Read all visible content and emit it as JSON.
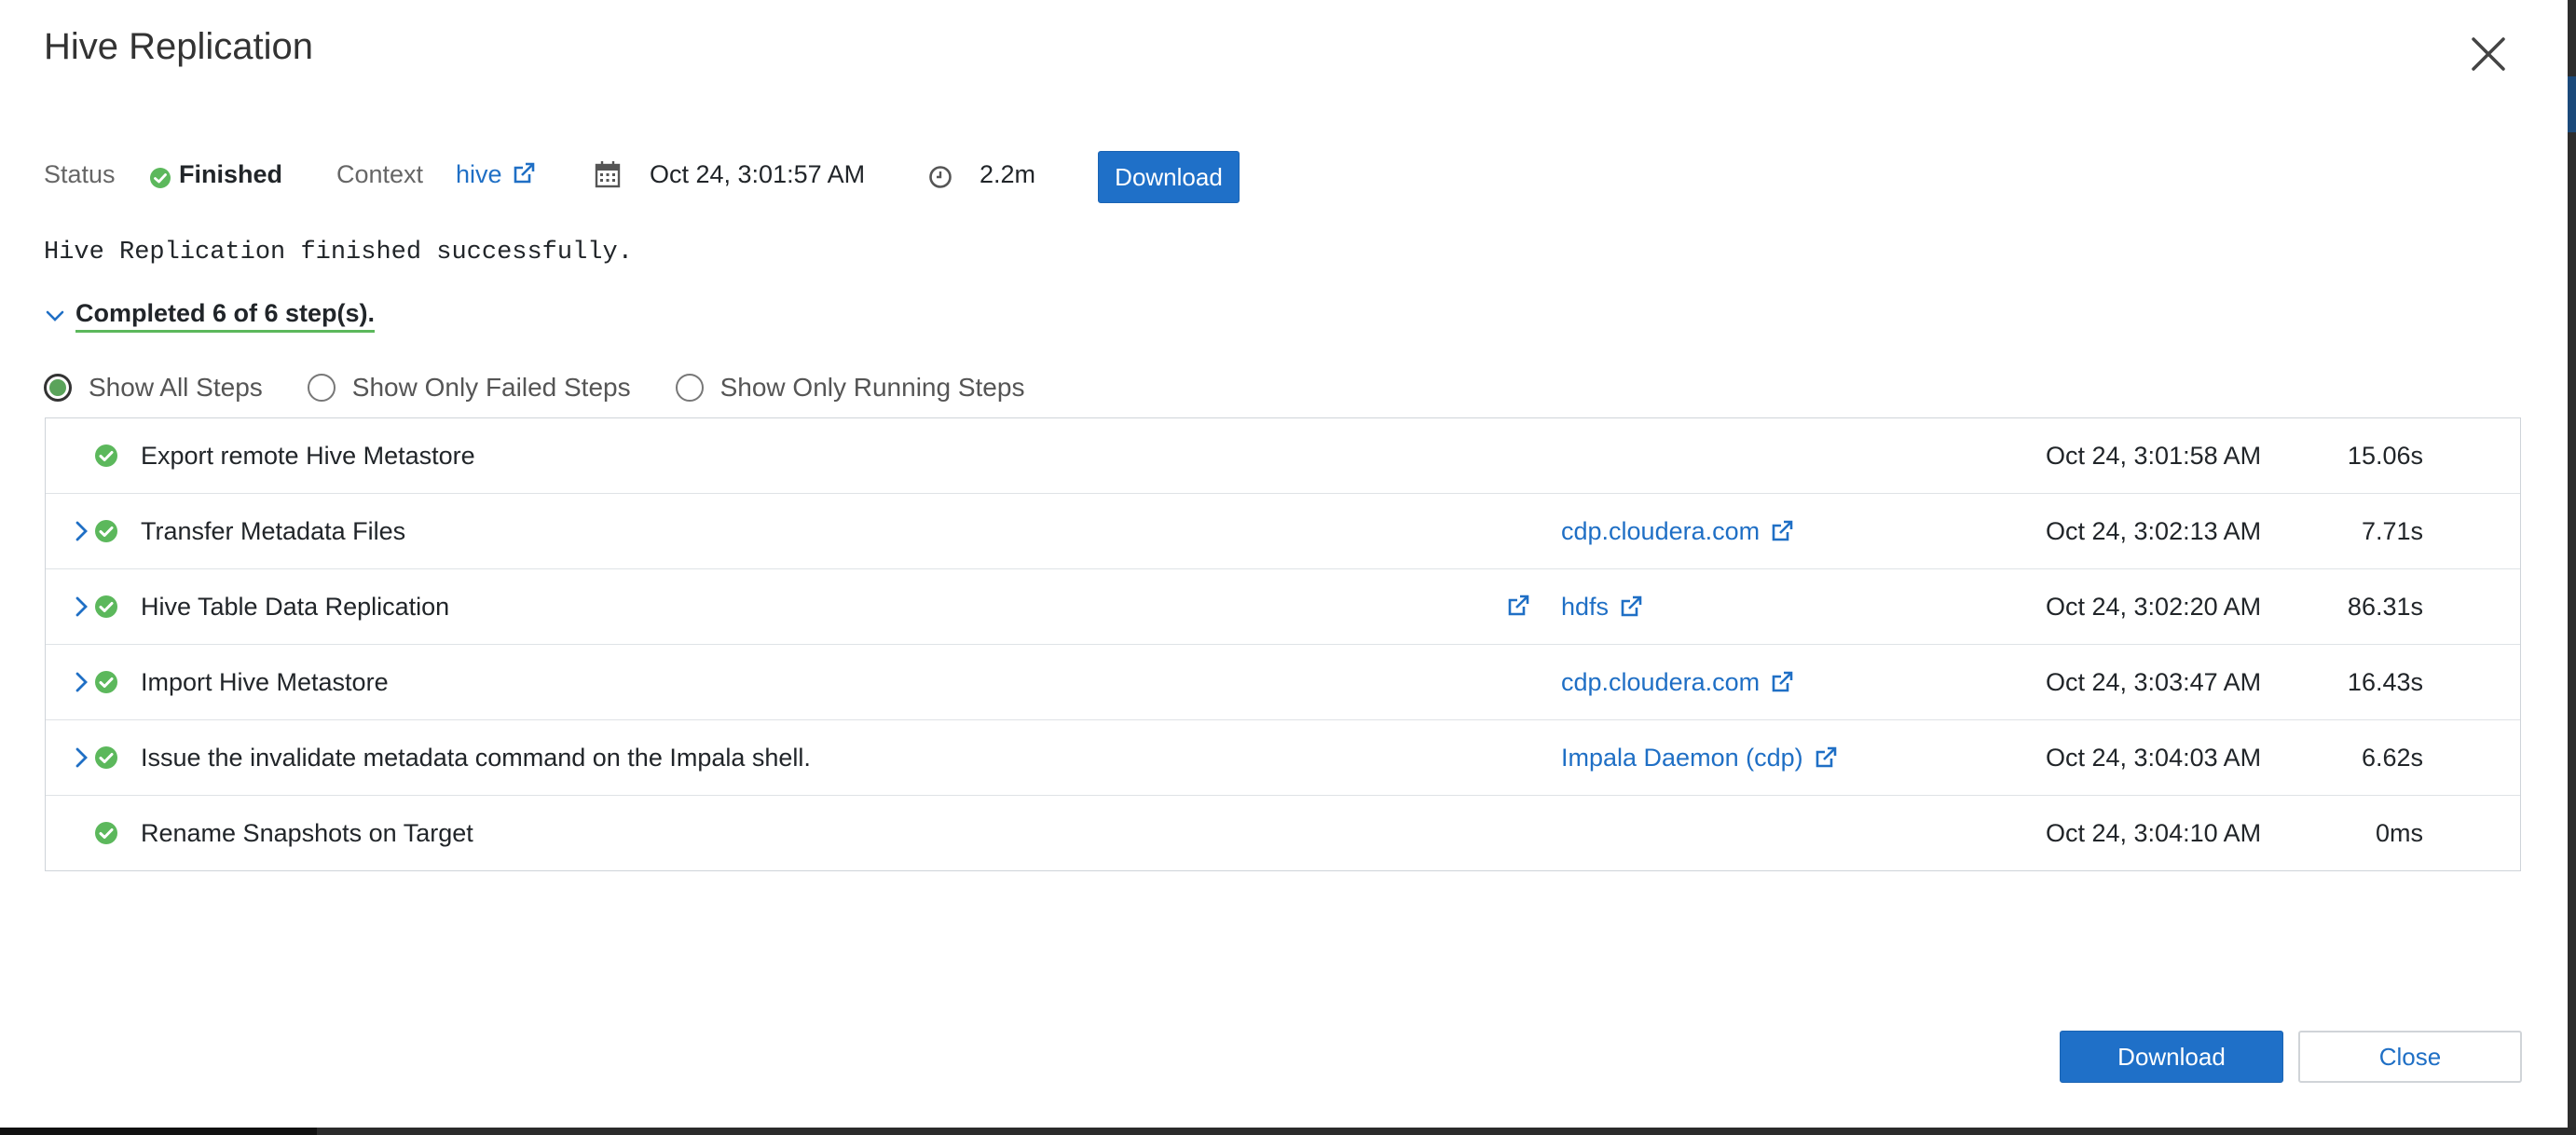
{
  "dialog": {
    "title": "Hive Replication",
    "close_icon": "close-icon"
  },
  "meta": {
    "status_label": "Status",
    "status_value": "Finished",
    "context_label": "Context",
    "context_value": "hive",
    "start_time": "Oct 24, 3:01:57 AM",
    "duration": "2.2m",
    "download_label": "Download"
  },
  "message": "Hive Replication finished successfully.",
  "summary": "Completed 6 of 6 step(s).",
  "filters": {
    "all": "Show All Steps",
    "failed": "Show Only Failed Steps",
    "running": "Show Only Running Steps",
    "selected": "all"
  },
  "steps": [
    {
      "name": "Export remote Hive Metastore",
      "context": "",
      "time": "Oct 24, 3:01:58 AM",
      "duration": "15.06s",
      "expandable": false
    },
    {
      "name": "Transfer Metadata Files",
      "context": "cdp.cloudera.com",
      "time": "Oct 24, 3:02:13 AM",
      "duration": "7.71s",
      "expandable": true
    },
    {
      "name": "Hive Table Data Replication",
      "context": "hdfs",
      "time": "Oct 24, 3:02:20 AM",
      "duration": "86.31s",
      "expandable": true
    },
    {
      "name": "Import Hive Metastore",
      "context": "cdp.cloudera.com",
      "time": "Oct 24, 3:03:47 AM",
      "duration": "16.43s",
      "expandable": true
    },
    {
      "name": "Issue the invalidate metadata command on the Impala shell.",
      "context": "Impala Daemon (cdp)",
      "time": "Oct 24, 3:04:03 AM",
      "duration": "6.62s",
      "expandable": true
    },
    {
      "name": "Rename Snapshots on Target",
      "context": "",
      "time": "Oct 24, 3:04:10 AM",
      "duration": "0ms",
      "expandable": false
    }
  ],
  "footer": {
    "download_label": "Download",
    "close_label": "Close"
  },
  "colors": {
    "primary": "#1f70c8",
    "success": "#5cb85c",
    "link": "#1f6fc5"
  }
}
